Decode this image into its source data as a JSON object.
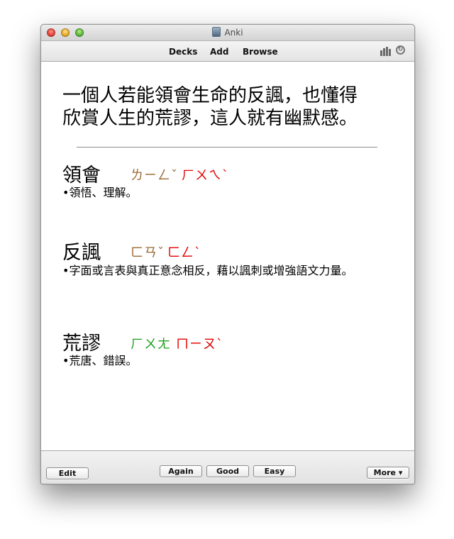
{
  "window": {
    "title": "Anki"
  },
  "toolbar": {
    "decks": "Decks",
    "add": "Add",
    "browse": "Browse"
  },
  "card": {
    "question_line1": "一個人若能領會生命的反諷，也懂得",
    "question_line2": "欣賞人生的荒謬，這人就有幽默感。",
    "entries": [
      {
        "term": "領會",
        "zhuyin1": "ㄌㄧㄥˇ",
        "zhuyin1_color": "#9a6a35",
        "zhuyin2": "ㄏㄨㄟˋ",
        "zhuyin2_color": "#e00000",
        "definition": "•領悟、理解。"
      },
      {
        "term": "反諷",
        "zhuyin1": "ㄈㄢˇ",
        "zhuyin1_color": "#9a6a35",
        "zhuyin2": "ㄈㄥˋ",
        "zhuyin2_color": "#e00000",
        "definition": "•字面或言表與真正意念相反，藉以諷刺或增強語文力量。"
      },
      {
        "term": "荒謬",
        "zhuyin1": "ㄏㄨㄤ",
        "zhuyin1_color": "#1aa01a",
        "zhuyin2": "ㄇㄧㄡˋ",
        "zhuyin2_color": "#e00000",
        "definition": "•荒唐、錯誤。"
      }
    ]
  },
  "bottom": {
    "edit": "Edit",
    "again": "Again",
    "good": "Good",
    "easy": "Easy",
    "more": "More ▾"
  },
  "icons": {
    "stats": "stats-icon",
    "sync": "sync-icon",
    "app": "anki-app-icon"
  }
}
